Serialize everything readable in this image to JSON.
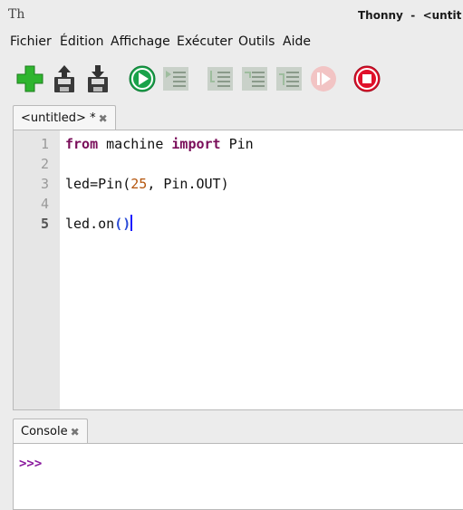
{
  "window": {
    "app_icon_text": "Th",
    "title": "Thonny  -  <untit"
  },
  "menu": {
    "items": [
      "Fichier",
      "Édition",
      "Affichage",
      "Exécuter",
      "Outils",
      "Aide"
    ]
  },
  "toolbar": {
    "icons": [
      "new-file-icon",
      "open-file-icon",
      "save-file-icon",
      "run-icon",
      "debug-icon",
      "step-over-icon",
      "step-into-icon",
      "step-out-icon",
      "resume-icon",
      "stop-icon"
    ],
    "colors": {
      "new": "#2fb52f",
      "run": "#1aa24a",
      "stop": "#e0102a",
      "disabled": "#a9c3a9"
    }
  },
  "editor": {
    "tab_label": "<untitled> *",
    "tab_close": "✖",
    "line_numbers": [
      "1",
      "2",
      "3",
      "4",
      "5"
    ],
    "current_line": 5,
    "lines": {
      "l1_kw1": "from",
      "l1_mid": " machine ",
      "l1_kw2": "import",
      "l1_end": " Pin",
      "l3_a": "led=Pin(",
      "l3_num": "25",
      "l3_b": ", Pin.OUT)",
      "l5_a": "led.on",
      "l5_open": "(",
      "l5_close": ")"
    }
  },
  "console": {
    "tab_label": "Console",
    "tab_close": "✖",
    "prompt": ">>>"
  }
}
